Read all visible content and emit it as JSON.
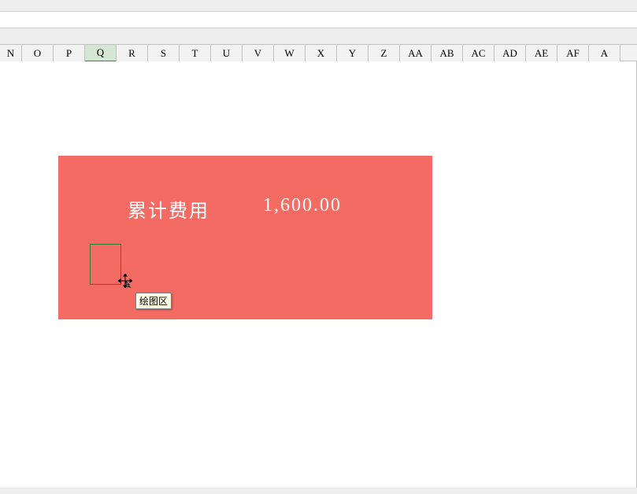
{
  "columns": [
    {
      "label": "N",
      "active": false,
      "first": true
    },
    {
      "label": "O",
      "active": false
    },
    {
      "label": "P",
      "active": false
    },
    {
      "label": "Q",
      "active": true
    },
    {
      "label": "R",
      "active": false
    },
    {
      "label": "S",
      "active": false
    },
    {
      "label": "T",
      "active": false
    },
    {
      "label": "U",
      "active": false
    },
    {
      "label": "V",
      "active": false
    },
    {
      "label": "W",
      "active": false
    },
    {
      "label": "X",
      "active": false
    },
    {
      "label": "Y",
      "active": false
    },
    {
      "label": "Z",
      "active": false
    },
    {
      "label": "AA",
      "active": false
    },
    {
      "label": "AB",
      "active": false
    },
    {
      "label": "AC",
      "active": false
    },
    {
      "label": "AD",
      "active": false
    },
    {
      "label": "AE",
      "active": false
    },
    {
      "label": "AF",
      "active": false
    },
    {
      "label": "A",
      "active": false,
      "last": true
    }
  ],
  "chart": {
    "label": "累计费用",
    "value": "1,600.00"
  },
  "tooltip": "绘图区",
  "chart_data": {
    "type": "table",
    "title": "累计费用",
    "values": [
      1600.0
    ]
  }
}
